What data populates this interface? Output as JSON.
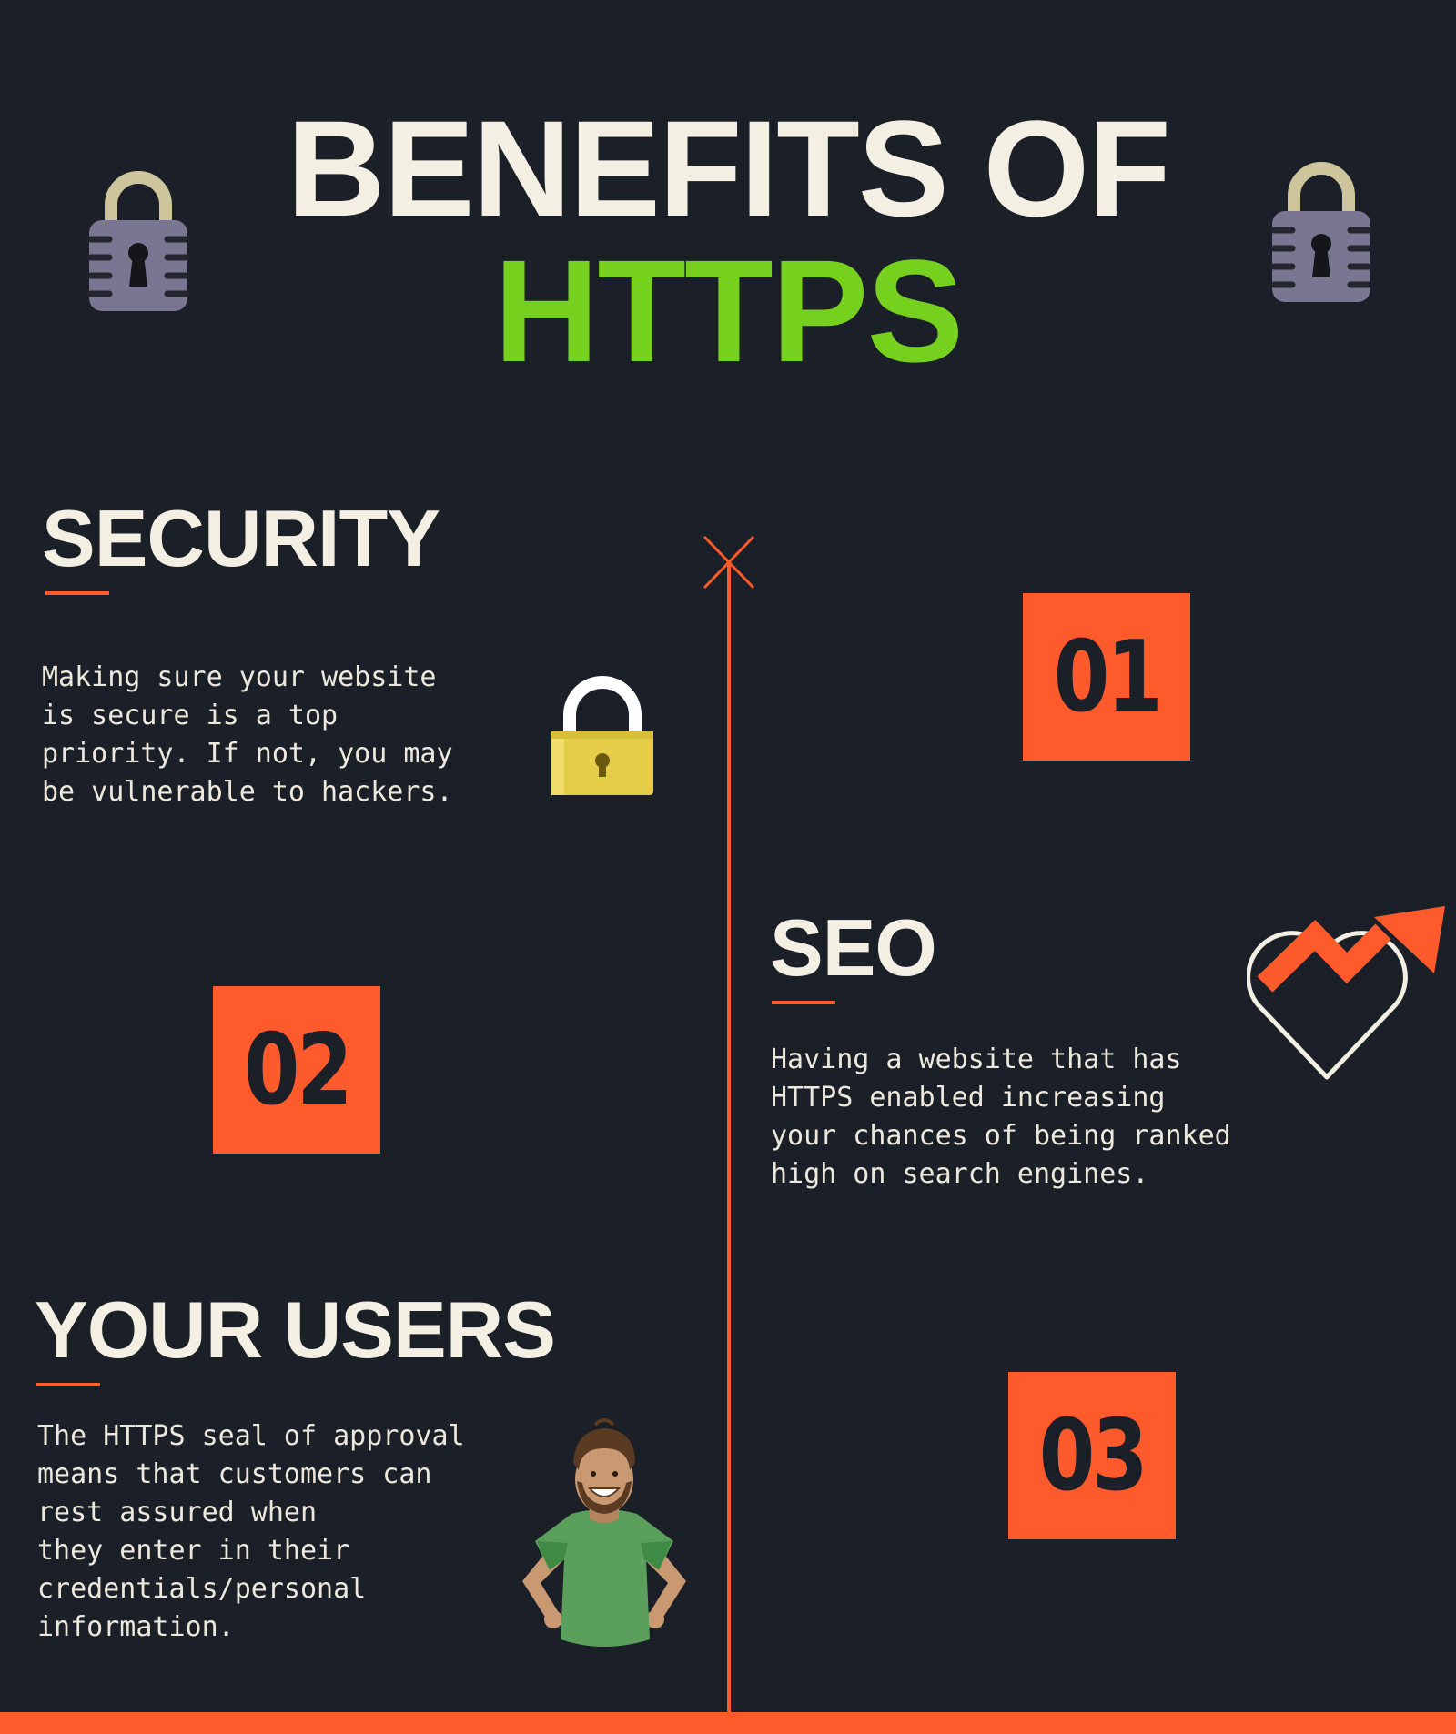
{
  "header": {
    "title_line1": "BENEFITS OF",
    "title_line2": "HTTPS"
  },
  "sections": [
    {
      "title": "SECURITY",
      "number": "01",
      "body": "Making sure your website\nis secure is a top\npriority. If not, you may\nbe vulnerable to hackers.",
      "icon": "padlock-icon"
    },
    {
      "title": "SEO",
      "number": "02",
      "body": "Having a website that has\nHTTPS enabled increasing\nyour chances of being ranked\nhigh on search engines.",
      "icon": "heart-trend-arrow-icon"
    },
    {
      "title": "YOUR USERS",
      "number": "03",
      "body": "The HTTPS seal of approval\nmeans that customers can\nrest assured when\nthey enter in their\ncredentials/personal\ninformation.",
      "icon": "person-illustration"
    }
  ],
  "colors": {
    "background": "#1b1f27",
    "accent": "#ff5a2c",
    "highlight": "#76d11f",
    "text": "#f3efe3"
  }
}
